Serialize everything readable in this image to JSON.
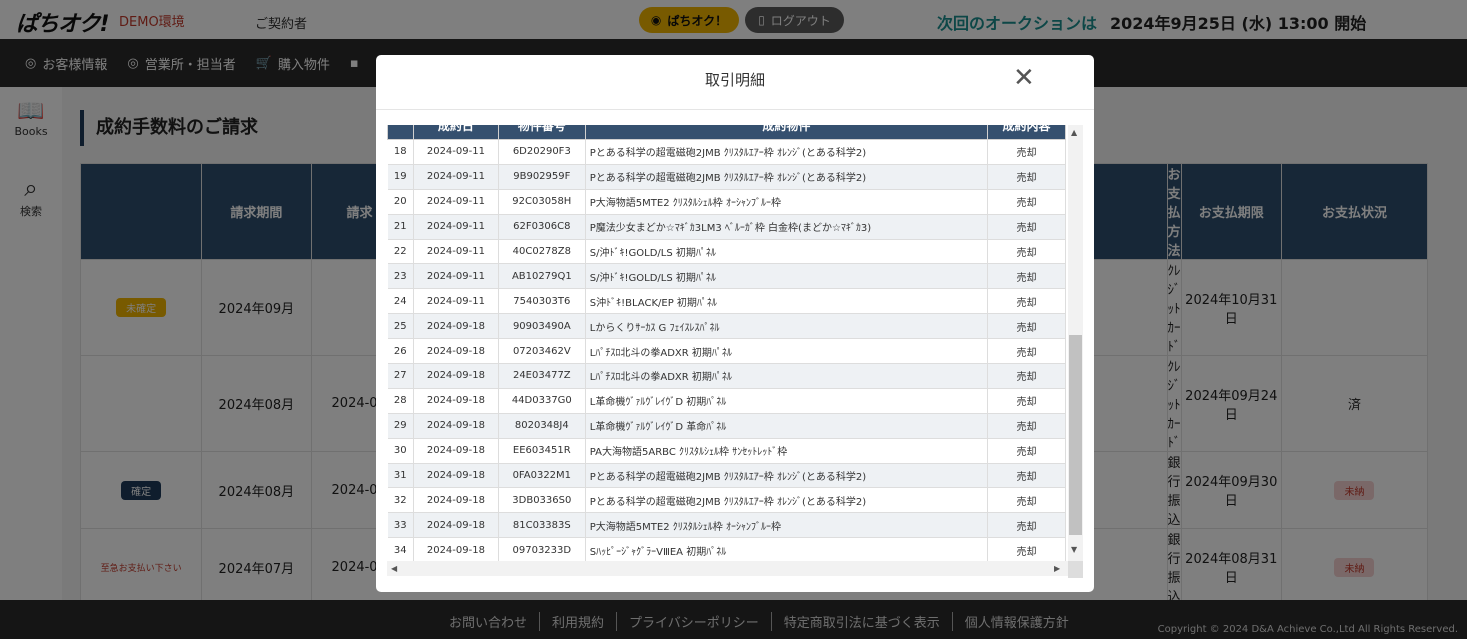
{
  "header": {
    "logo": "ぱちオク!",
    "env": "DEMO環境",
    "contract": "ご契約者",
    "user_button": "ぱちオク！",
    "logout_button": "ログアウト",
    "next_auction_label": "次回のオークションは",
    "next_auction_date": "2024年9月25日 (水) 13:00 開始"
  },
  "nav": {
    "items": [
      {
        "label": "お客様情報",
        "icon": "user-circle-icon"
      },
      {
        "label": "営業所・担当者",
        "icon": "user-circle-icon"
      },
      {
        "label": "購入物件",
        "icon": "cart-icon"
      }
    ]
  },
  "sidebar": {
    "books": "Books",
    "search": "検索"
  },
  "page": {
    "title": "成約手数料のご請求",
    "columns": [
      "",
      "請求期間",
      "請求",
      "お支払方法",
      "お支払期限",
      "お支払状況"
    ],
    "rows": [
      {
        "status": "未確定",
        "period": "2024年09月",
        "partial": "",
        "method": "ｸﾚｼﾞｯﾄｶｰﾄﾞ",
        "deadline": "2024年10月31日",
        "pay_status": ""
      },
      {
        "status": "",
        "period": "2024年08月",
        "partial": "2024-0",
        "method": "ｸﾚｼﾞｯﾄｶｰﾄﾞ",
        "deadline": "2024年09月24日",
        "pay_status": "済"
      },
      {
        "status": "確定",
        "period": "2024年08月",
        "partial": "2024-0",
        "method": "銀行振込",
        "deadline": "2024年09月30日",
        "pay_status": "未納"
      },
      {
        "status": "至急お支払い下さい",
        "period": "2024年07月",
        "partial": "2024-0",
        "method": "銀行振込",
        "deadline": "2024年08月31日",
        "pay_status": "未納"
      }
    ]
  },
  "modal": {
    "title": "取引明細",
    "columns": [
      "",
      "成約日",
      "物件番号",
      "成約物件",
      "成約内容"
    ],
    "rows": [
      {
        "no": "18",
        "date": "2024-09-11",
        "id": "6D20290F3",
        "item": "Pとある科学の超電磁砲2JMB ｸﾘｽﾀﾙｴｱｰ枠 ｵﾚﾝｼﾞ(とある科学2)",
        "type": "売却"
      },
      {
        "no": "19",
        "date": "2024-09-11",
        "id": "9B902959F",
        "item": "Pとある科学の超電磁砲2JMB ｸﾘｽﾀﾙｴｱｰ枠 ｵﾚﾝｼﾞ(とある科学2)",
        "type": "売却"
      },
      {
        "no": "20",
        "date": "2024-09-11",
        "id": "92C03058H",
        "item": "P大海物語5MTE2 ｸﾘｽﾀﾙｼｪﾙ枠 ｵｰｼｬﾝﾌﾞﾙｰ枠",
        "type": "売却"
      },
      {
        "no": "21",
        "date": "2024-09-11",
        "id": "62F0306C8",
        "item": "P魔法少女まどか☆ﾏｷﾞｶ3LM3 ﾍﾞﾙｰｶﾞ枠 白金枠(まどか☆ﾏｷﾞｶ3)",
        "type": "売却"
      },
      {
        "no": "22",
        "date": "2024-09-11",
        "id": "40C0278Z8",
        "item": "S/沖ﾄﾞｷ!GOLD/LS 初期ﾊﾟﾈﾙ",
        "type": "売却"
      },
      {
        "no": "23",
        "date": "2024-09-11",
        "id": "AB10279Q1",
        "item": "S/沖ﾄﾞｷ!GOLD/LS 初期ﾊﾟﾈﾙ",
        "type": "売却"
      },
      {
        "no": "24",
        "date": "2024-09-11",
        "id": "7540303T6",
        "item": "S沖ﾄﾞｷ!BLACK/EP 初期ﾊﾟﾈﾙ",
        "type": "売却"
      },
      {
        "no": "25",
        "date": "2024-09-18",
        "id": "90903490A",
        "item": "Lからくりｻｰｶｽ G ﾌｪｲｽﾚｽﾊﾟﾈﾙ",
        "type": "売却"
      },
      {
        "no": "26",
        "date": "2024-09-18",
        "id": "07203462V",
        "item": "Lﾊﾟﾁｽﾛ北斗の拳ADXR 初期ﾊﾟﾈﾙ",
        "type": "売却"
      },
      {
        "no": "27",
        "date": "2024-09-18",
        "id": "24E03477Z",
        "item": "Lﾊﾟﾁｽﾛ北斗の拳ADXR 初期ﾊﾟﾈﾙ",
        "type": "売却"
      },
      {
        "no": "28",
        "date": "2024-09-18",
        "id": "44D0337G0",
        "item": "L革命機ｳﾞｧﾙｳﾞﾚｲｳﾞD 初期ﾊﾟﾈﾙ",
        "type": "売却"
      },
      {
        "no": "29",
        "date": "2024-09-18",
        "id": "8020348J4",
        "item": "L革命機ｳﾞｧﾙｳﾞﾚｲｳﾞD 革命ﾊﾟﾈﾙ",
        "type": "売却"
      },
      {
        "no": "30",
        "date": "2024-09-18",
        "id": "EE603451R",
        "item": "PA大海物語5ARBC ｸﾘｽﾀﾙｼｪﾙ枠 ｻﾝｾｯﾄﾚｯﾄﾞ枠",
        "type": "売却"
      },
      {
        "no": "31",
        "date": "2024-09-18",
        "id": "0FA0322M1",
        "item": "Pとある科学の超電磁砲2JMB ｸﾘｽﾀﾙｴｱｰ枠 ｵﾚﾝｼﾞ(とある科学2)",
        "type": "売却"
      },
      {
        "no": "32",
        "date": "2024-09-18",
        "id": "3DB0336S0",
        "item": "Pとある科学の超電磁砲2JMB ｸﾘｽﾀﾙｴｱｰ枠 ｵﾚﾝｼﾞ(とある科学2)",
        "type": "売却"
      },
      {
        "no": "33",
        "date": "2024-09-18",
        "id": "81C03383S",
        "item": "P大海物語5MTE2 ｸﾘｽﾀﾙｼｪﾙ枠 ｵｰｼｬﾝﾌﾞﾙｰ枠",
        "type": "売却"
      },
      {
        "no": "34",
        "date": "2024-09-18",
        "id": "09703233D",
        "item": "SﾊｯﾋﾟｰｼﾞｬｸﾞﾗｰVⅢEA 初期ﾊﾟﾈﾙ",
        "type": "売却"
      }
    ]
  },
  "footer": {
    "links": [
      "お問い合わせ",
      "利用規約",
      "プライバシーポリシー",
      "特定商取引法に基づく表示",
      "個人情報保護方針"
    ],
    "copyright": "Copyright © 2024 D&A Achieve Co.,Ltd All Rights Reserved."
  },
  "colors": {
    "nav_bg": "#2b2b2b",
    "table_header": "#35506f",
    "accent_yellow": "#f0b400",
    "teal": "#1a8f8f"
  }
}
